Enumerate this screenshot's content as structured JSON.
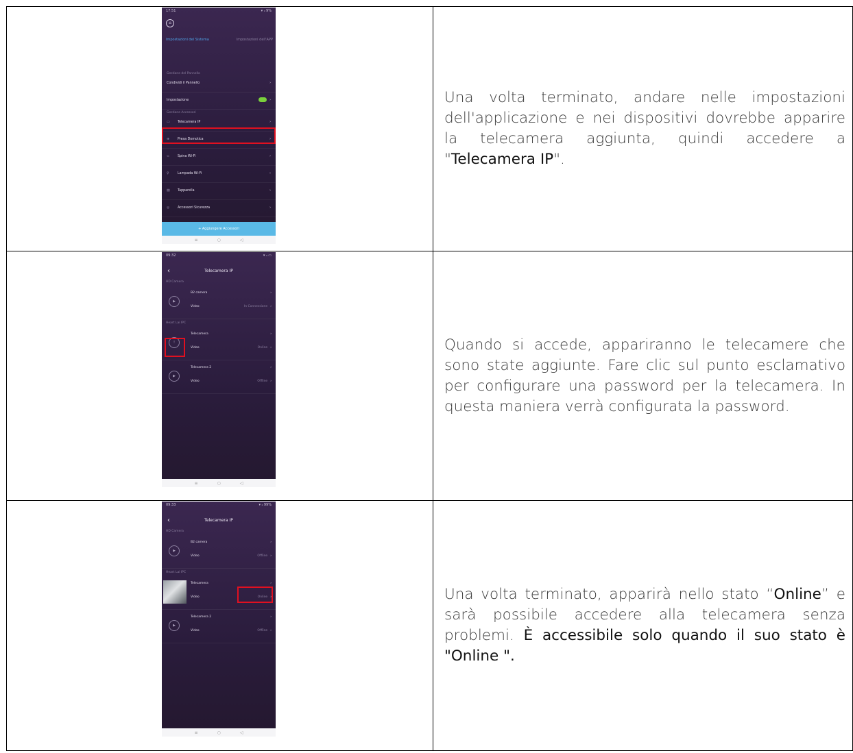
{
  "rows": [
    {
      "text": [
        {
          "t": "Una volta terminato, andare nelle impostazioni dell'applicazione e nei dispositivi dovrebbe apparire la telecamera aggiunta, quindi accedere a \"",
          "hl": false
        },
        {
          "t": "Telecamera IP",
          "hl": true
        },
        {
          "t": "\".",
          "hl": false
        }
      ],
      "phone": {
        "status_time": "17:51",
        "status_icons": "▾ ᵢₗ 9%",
        "tabs": [
          "Impostazioni del Sistema",
          "Impostazioni dell'APP"
        ],
        "section1": "Gestione del Pannello",
        "items1": [
          "Condividi il Pannello",
          "Impostazione"
        ],
        "section2": "Gestione Accessori",
        "items2": [
          "Telecamera IP",
          "Presa Domotica",
          "Spina Wi-Fi",
          "Lampada Wi-Fi",
          "Tapparella",
          "Accessori Sicurezza"
        ],
        "add_button": "+ Aggiungere Accessori"
      }
    },
    {
      "text": [
        {
          "t": "Quando si accede, appariranno le telecamere che sono state aggiunte. Fare clic sul punto esclamativo per configurare una password per la telecamera. In questa maniera verrà configurata la password.",
          "hl": false
        }
      ],
      "phone": {
        "status_time": "09:32",
        "title": "Telecamera IP",
        "group1": "HD Camera",
        "group2": "Heart Lai IPC",
        "cams": [
          {
            "name": "B2 camera",
            "video": "Video",
            "status": "In Connessione"
          },
          {
            "name": "Telecamera",
            "video": "Video",
            "status": "Online"
          },
          {
            "name": "Telecamera 2",
            "video": "Video",
            "status": "Offline"
          }
        ]
      }
    },
    {
      "text": [
        {
          "t": "Una volta terminato, apparirà nello stato “",
          "hl": false
        },
        {
          "t": "Online",
          "hl": true
        },
        {
          "t": "” e sarà possibile accedere alla telecamera senza problemi. ",
          "hl": false
        },
        {
          "t": "È accessibile solo quando il suo stato è \"Online \".",
          "hl": true
        }
      ],
      "phone": {
        "status_time": "09:33",
        "title": "Telecamera IP",
        "group1": "HD Camera",
        "group2": "Heart Lai IPC",
        "cams": [
          {
            "name": "B2 camera",
            "video": "Video",
            "status": "Offline"
          },
          {
            "name": "Telecamera",
            "video": "Video",
            "status": "Online"
          },
          {
            "name": "Telecamera 2",
            "video": "Video",
            "status": "Offline"
          }
        ]
      }
    }
  ]
}
